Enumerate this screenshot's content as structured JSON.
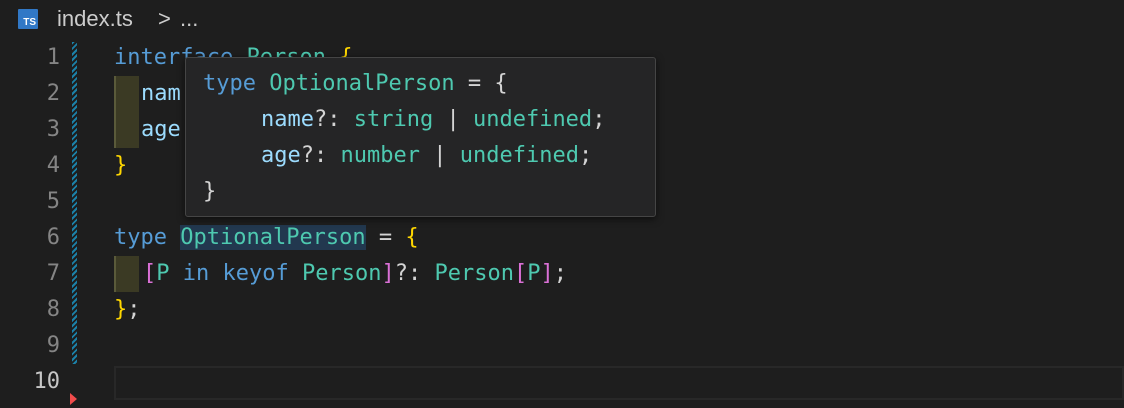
{
  "breadcrumb": {
    "file_icon_text": "TS",
    "file_name": "index.ts",
    "separator": ">",
    "ellipsis": "..."
  },
  "gutter": {
    "lines": [
      "1",
      "2",
      "3",
      "4",
      "5",
      "6",
      "7",
      "8",
      "9",
      "10"
    ],
    "active_line": "10"
  },
  "code": {
    "line1": {
      "kw": "interface",
      "name": "Person",
      "brace": "{"
    },
    "line2": {
      "prop": "nam"
    },
    "line3": {
      "prop": "age"
    },
    "line4": {
      "brace": "}"
    },
    "line6": {
      "kw": "type",
      "name": "OptionalPerson",
      "eq": "=",
      "brace": "{"
    },
    "line7": {
      "open": "[",
      "param": "P",
      "in_kw": "in",
      "keyof_kw": "keyof",
      "type": "Person",
      "close": "]",
      "optional": "?:",
      "index_type": "Person",
      "idx_open": "[",
      "idx_param": "P",
      "idx_close": "]",
      "semi": ";"
    },
    "line8": {
      "brace": "}",
      "semi": ";"
    }
  },
  "hover": {
    "line1": {
      "kw": "type",
      "name": "OptionalPerson",
      "eq": "=",
      "brace": "{"
    },
    "line2": {
      "prop": "name",
      "opt": "?:",
      "t1": "string",
      "pipe": "|",
      "t2": "undefined",
      "semi": ";"
    },
    "line3": {
      "prop": "age",
      "opt": "?:",
      "t1": "number",
      "pipe": "|",
      "t2": "undefined",
      "semi": ";"
    },
    "line4": {
      "brace": "}"
    }
  },
  "colors": {
    "keyword": "#569cd6",
    "type": "#4ec9b0",
    "property": "#9cdcfe",
    "bracket_gold": "#ffd700",
    "bracket_pink": "#da70d6",
    "git_modified": "#1b81a8",
    "git_deleted": "#f14c4c"
  }
}
